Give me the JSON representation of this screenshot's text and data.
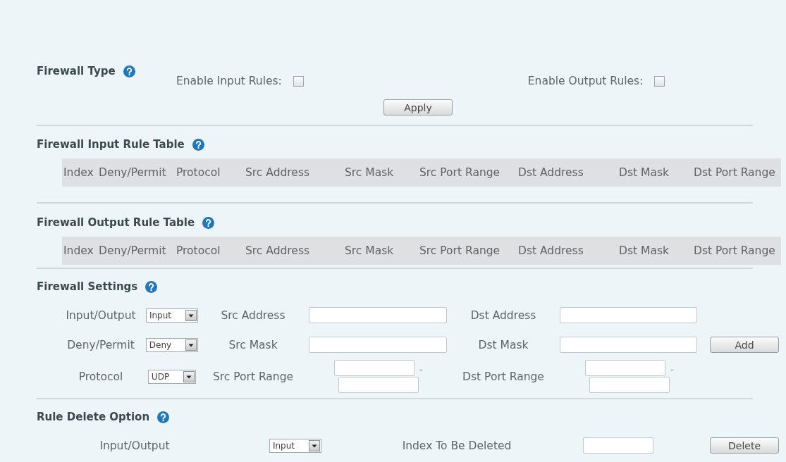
{
  "sections": [
    {
      "kind": "firewall_type",
      "title": "Firewall Type",
      "toggles": [
        {
          "label": "Enable Input Rules:",
          "checked": false
        },
        {
          "label": "Enable Output Rules:",
          "checked": false
        }
      ],
      "button": "Apply"
    },
    {
      "kind": "rule_table",
      "title": "Firewall Input Rule Table",
      "columns": [
        "Index",
        "Deny/Permit",
        "Protocol",
        "Src Address",
        "Src Mask",
        "Src Port Range",
        "Dst Address",
        "Dst Mask",
        "Dst Port Range"
      ]
    },
    {
      "kind": "rule_table",
      "title": "Firewall Output Rule Table",
      "columns": [
        "Index",
        "Deny/Permit",
        "Protocol",
        "Src Address",
        "Src Mask",
        "Src Port Range",
        "Dst Address",
        "Dst Mask",
        "Dst Port Range"
      ]
    },
    {
      "kind": "settings",
      "title": "Firewall Settings",
      "rows": [
        {
          "fields": [
            {
              "kind": "select",
              "label": "Input/Output",
              "value": "Input"
            },
            {
              "kind": "text",
              "label": "Src Address"
            },
            {
              "kind": "text",
              "label": "Dst Address"
            }
          ]
        },
        {
          "fields": [
            {
              "kind": "select",
              "label": "Deny/Permit",
              "value": "Deny"
            },
            {
              "kind": "text",
              "label": "Src Mask"
            },
            {
              "kind": "text",
              "label": "Dst Mask"
            }
          ],
          "button": "Add"
        },
        {
          "fields": [
            {
              "kind": "select",
              "label": "Protocol",
              "value": "UDP"
            },
            {
              "kind": "range",
              "label": "Src Port Range",
              "separator": "-"
            },
            {
              "kind": "range",
              "label": "Dst Port Range",
              "separator": "-"
            }
          ]
        }
      ]
    },
    {
      "kind": "delete",
      "title": "Rule Delete Option",
      "fields": [
        {
          "kind": "select",
          "label": "Input/Output",
          "value": "Input"
        },
        {
          "kind": "text",
          "label": "Index To Be Deleted"
        }
      ],
      "button": "Delete"
    }
  ]
}
